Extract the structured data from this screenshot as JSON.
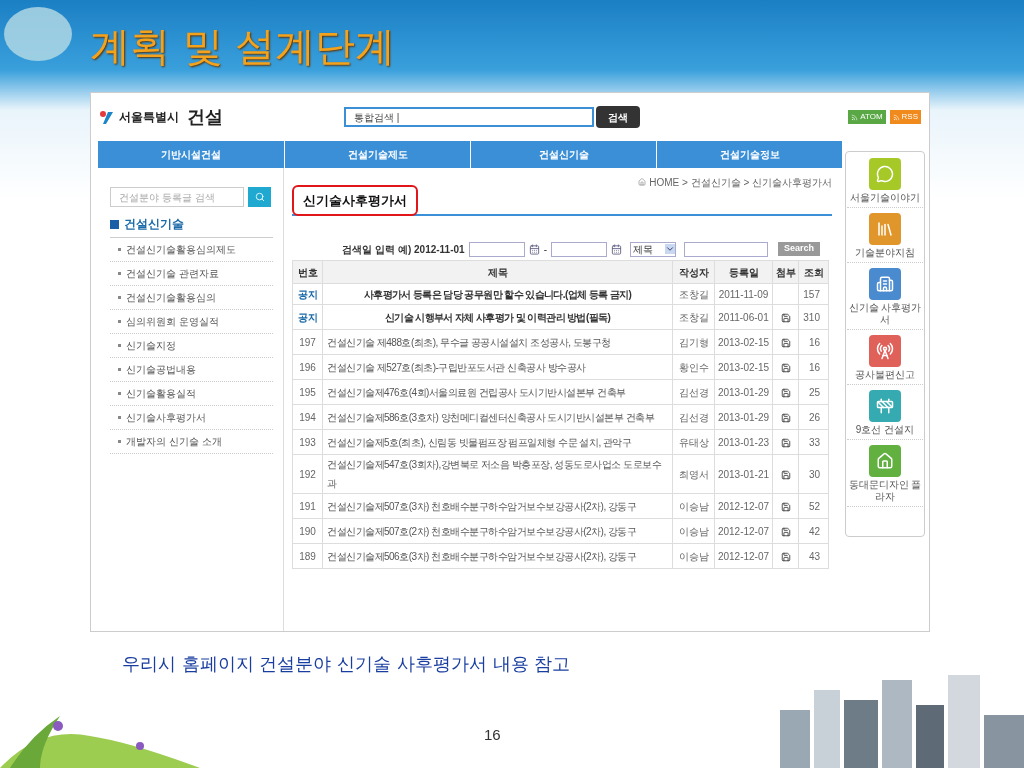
{
  "slide": {
    "title": "계획 및 설계단계",
    "caption": "우리시 홈페이지 건설분야 신기술 사후평가서 내용 참고",
    "page_number": "16"
  },
  "site": {
    "logo": "서울특별시",
    "logo_bold": "건설",
    "search_value": "통합검색 |",
    "search_button": "검색",
    "feeds": [
      {
        "label": "ATOM",
        "color": "#5aa845"
      },
      {
        "label": "RSS",
        "color": "#f08a1c"
      }
    ]
  },
  "nav": [
    "기반시설건설",
    "건설기술제도",
    "건설신기술",
    "건설기술정보"
  ],
  "sidebar": {
    "search_placeholder": "건설분야 등록글 검색",
    "heading": "건설신기술",
    "items": [
      "건설신기술활용심의제도",
      "건설신기술 관련자료",
      "건설신기술활용심의",
      "심의위원회 운영실적",
      "신기술지정",
      "신기술공법내용",
      "신기술활용실적",
      "신기술사후평가서",
      "개발자의 신기술 소개"
    ]
  },
  "breadcrumb": "HOME > 건설신기술 > 신기술사후평가서",
  "page_title": "신기술사후평가서",
  "filter": {
    "label": "검색일 입력 예) 2012-11-01",
    "dash": "-",
    "select": "제목",
    "button": "Search"
  },
  "table": {
    "columns": [
      "번호",
      "제목",
      "작성자",
      "등록일",
      "첨부",
      "조회"
    ],
    "rows": [
      {
        "kind": "notice",
        "number": "공지",
        "title": "사후평가서 등록은 담당 공무원만 할수 있습니다.(업체 등록 금지)",
        "author": "조창길",
        "date": "2011-11-09",
        "attachment": false,
        "views": "157"
      },
      {
        "kind": "notice",
        "number": "공지",
        "title": "신기술 시행부서 자체 사후평가 및 이력관리 방법(필독)",
        "author": "조창길",
        "date": "2011-06-01",
        "attachment": true,
        "views": "310"
      },
      {
        "kind": "post",
        "number": "197",
        "title": "건설신기술 제488호(최초), 무수글 공공시설설치 조성공사, 도봉구청",
        "author": "김기형",
        "date": "2013-02-15",
        "attachment": true,
        "views": "16"
      },
      {
        "kind": "post",
        "number": "196",
        "title": "건설신기술 제527호(최초)-구립반포도서관 신축공사 방수공사",
        "author": "황인수",
        "date": "2013-02-15",
        "attachment": true,
        "views": "16"
      },
      {
        "kind": "post",
        "number": "195",
        "title": "건설신기술제476호(4회)서울의료원 건립공사 도시기반시설본부 건축부",
        "author": "김선경",
        "date": "2013-01-29",
        "attachment": true,
        "views": "25"
      },
      {
        "kind": "post",
        "number": "194",
        "title": "건설신기술제586호(3호차) 양천메디컬센터신축공사 도시기반시설본부 건축부",
        "author": "김선경",
        "date": "2013-01-29",
        "attachment": true,
        "views": "26"
      },
      {
        "kind": "post",
        "number": "193",
        "title": "건설신기술제5호(최초), 신림동 빗물펌프장 펌프일체형 수문 설치, 관악구",
        "author": "유태상",
        "date": "2013-01-23",
        "attachment": true,
        "views": "33"
      },
      {
        "kind": "post",
        "number": "192",
        "title": "건설신기술제547호(3회차),강변북로 저소음 박층포장, 성동도로사업소 도로보수과",
        "author": "최영서",
        "date": "2013-01-21",
        "attachment": true,
        "views": "30"
      },
      {
        "kind": "post",
        "number": "191",
        "title": "건설신기술제507호(3차) 천호배수분구하수암거보수보강공사(2차), 강동구",
        "author": "이승남",
        "date": "2012-12-07",
        "attachment": true,
        "views": "52"
      },
      {
        "kind": "post",
        "number": "190",
        "title": "건설신기술제507호(2차) 천호배수분구하수암거보수보강공사(2차), 강동구",
        "author": "이승남",
        "date": "2012-12-07",
        "attachment": true,
        "views": "42"
      },
      {
        "kind": "post",
        "number": "189",
        "title": "건설신기술제506호(3차) 천호배수분구하수암거보수보강공사(2차), 강동구",
        "author": "이승남",
        "date": "2012-12-07",
        "attachment": true,
        "views": "43"
      }
    ]
  },
  "quick_menu": [
    {
      "label": "서울기술이야기",
      "color": "#a6c928"
    },
    {
      "label": "기술분야지침",
      "color": "#e0962a"
    },
    {
      "label": "신기술 사후평가서",
      "color": "#4a8bd0"
    },
    {
      "label": "공사불편신고",
      "color": "#e0605a"
    },
    {
      "label": "9호선 건설지",
      "color": "#35aab0"
    },
    {
      "label": "동대문디자인 플라자",
      "color": "#62b040"
    }
  ]
}
